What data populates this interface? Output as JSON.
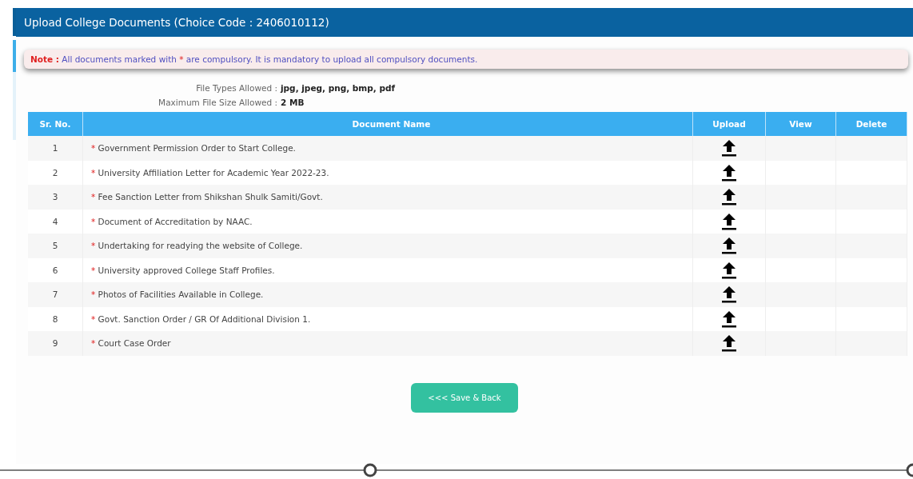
{
  "panel": {
    "title": "Upload College Documents (Choice Code : 2406010112)"
  },
  "note": {
    "label": "Note :",
    "text_before": "All documents marked with",
    "marker": "*",
    "text_after": "are compulsory. It is mandatory to upload all compulsory documents."
  },
  "info": [
    {
      "label": "File Types Allowed :",
      "value": "jpg, jpeg, png, bmp, pdf"
    },
    {
      "label": "Maximum File Size Allowed :",
      "value": "2 MB"
    }
  ],
  "table": {
    "columns": [
      "Sr. No.",
      "Document Name",
      "Upload",
      "View",
      "Delete"
    ],
    "rows": [
      {
        "sr": "1",
        "marker": "*",
        "name": "Government Permission Order to Start College."
      },
      {
        "sr": "2",
        "marker": "*",
        "name": "University Affiliation Letter for Academic Year 2022-23."
      },
      {
        "sr": "3",
        "marker": "*",
        "name": "Fee Sanction Letter from Shikshan Shulk Samiti/Govt."
      },
      {
        "sr": "4",
        "marker": "*",
        "name": "Document of Accreditation by NAAC."
      },
      {
        "sr": "5",
        "marker": "*",
        "name": "Undertaking for readying the website of College."
      },
      {
        "sr": "6",
        "marker": "*",
        "name": "University approved College Staff Profiles."
      },
      {
        "sr": "7",
        "marker": "*",
        "name": "Photos of Facilities Available in College."
      },
      {
        "sr": "8",
        "marker": "*",
        "name": "Govt. Sanction Order / GR Of Additional Division 1."
      },
      {
        "sr": "9",
        "marker": "*",
        "name": "Court Case Order"
      }
    ]
  },
  "button": {
    "label": "<<< Save & Back"
  }
}
